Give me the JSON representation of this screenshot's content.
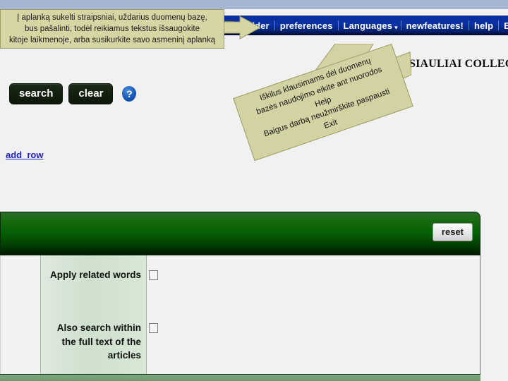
{
  "app": {
    "college_title": "SIAULIAI COLLEGE"
  },
  "navbar": {
    "folder_icon": "folder-icon",
    "items": [
      {
        "label": "folder"
      },
      {
        "label": "preferences"
      },
      {
        "label": "Languages"
      },
      {
        "label": "newfeatures!"
      },
      {
        "label": "help"
      },
      {
        "label": "Exit"
      }
    ],
    "languages_caret": "▾"
  },
  "toolbar": {
    "search_label": "search",
    "clear_label": "clear",
    "help_icon_glyph": "?",
    "add_row_label": "add_row"
  },
  "panel": {
    "reset_label": "reset",
    "options": [
      {
        "label": "Apply related words",
        "checked": false
      },
      {
        "label": "Also search within the\nfull text of the articles",
        "checked": false
      }
    ]
  },
  "callouts": {
    "top_left": {
      "text": "Į aplanką sukelti straipsniai, uždarius duomenų bazę,\nbus pašalinti, todėl reikiamus tekstus išsaugokite\nkitoje  laikmenoje, arba susikurkite savo asmeninį aplanką"
    },
    "rotated": {
      "text": "Iškilus klausimams dėl duomenų\nbazės naudojimo eikite ant nuorodos\nHelp\nBaigus darbą neužmirškite paspausti\nExit"
    }
  },
  "colors": {
    "nav_blue": "#0a31a6",
    "callout_tan": "#d6d6a5",
    "panel_green": "#046004",
    "button_dark": "#14200f",
    "link_blue": "#2020c8"
  }
}
